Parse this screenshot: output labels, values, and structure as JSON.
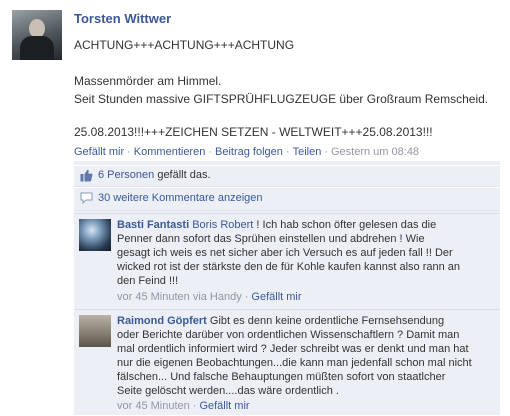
{
  "post": {
    "author": "Torsten Wittwer",
    "lines": [
      "ACHTUNG+++ACHTUNG+++ACHTUNG",
      "Massenmörder am Himmel.",
      "Seit Stunden massive GIFTSPRÜHFLUGZEUGE über Großraum Remscheid.",
      "25.08.2013!!!+++ZEICHEN SETZEN - WELTWEIT+++25.08.2013!!!"
    ]
  },
  "actions": {
    "like": "Gefällt mir",
    "comment": "Kommentieren",
    "follow": "Beitrag folgen",
    "share": "Teilen",
    "timestamp": "Gestern um 08:48",
    "separator": "·"
  },
  "feedback": {
    "likes_link": "6 Personen",
    "likes_suffix": " gefällt das.",
    "more_comments": "30 weitere Kommentare anzeigen"
  },
  "comments": [
    {
      "author": "Basti Fantasti",
      "mention": "Boris Robert",
      "lines": [
        " ! Ich hab schon öfter gelesen das die",
        "Penner dann sofort das Sprühen einstellen und abdrehen ! Wie",
        "gesagt ich weis es net sicher aber ich Versuch es auf jeden fall !! Der",
        "wicked rot ist der stärkste den de für Kohle kaufen kannst also rann an",
        "den Feind !!!"
      ],
      "time": "vor 45 Minuten via Handy",
      "like": "Gefällt mir"
    },
    {
      "author": "Raimond Göpfert",
      "mention": "",
      "lines": [
        " Gibt es denn keine ordentliche Fernsehsendung",
        "oder Berichte darüber von ordentlichen Wissenschaftlern ? Damit man",
        "mal ordentlich informiert wird ? Jeder schreibt was er denkt und man hat",
        "nur die eigenen Beobachtungen...die kann man jedenfall schon mal nicht",
        "fälschen... Und falsche Behauptungen müßten sofort von staatlcher",
        "Seite gelöscht werden....das wäre ordentlich ."
      ],
      "time": "vor 45 Minuten",
      "like": "Gefällt mir"
    }
  ]
}
